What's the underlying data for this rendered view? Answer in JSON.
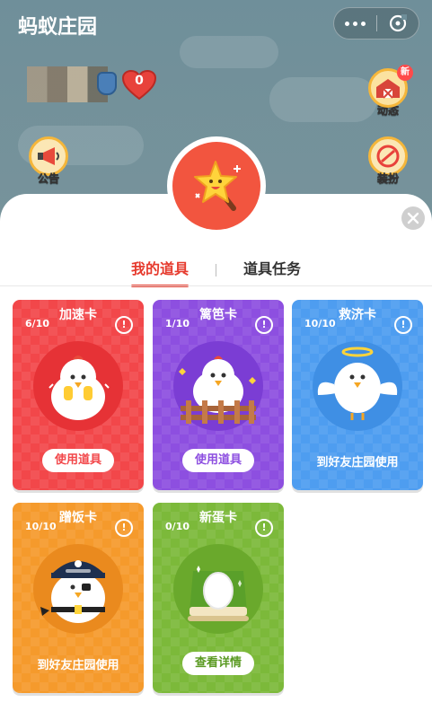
{
  "app": {
    "title": "蚂蚁庄园"
  },
  "user": {
    "heart_count": "0"
  },
  "side_buttons": {
    "announce": "公告",
    "news": "动态",
    "news_tag": "新",
    "dress": "装扮"
  },
  "tabs": [
    {
      "label": "我的道具",
      "active": true
    },
    {
      "label": "道具任务",
      "active": false
    }
  ],
  "cards": [
    {
      "title": "加速卡",
      "count": "6/10",
      "action": "使用道具",
      "color": "#f2474a",
      "action_color": "#f2474a",
      "button": true
    },
    {
      "title": "篱笆卡",
      "count": "1/10",
      "action": "使用道具",
      "color": "#8d4fe0",
      "action_color": "#8d4fe0",
      "button": true
    },
    {
      "title": "救济卡",
      "count": "10/10",
      "action": "到好友庄园使用",
      "color": "#4e9df0",
      "action_color": "#ffffff",
      "button": false
    },
    {
      "title": "蹭饭卡",
      "count": "10/10",
      "action": "到好友庄园使用",
      "color": "#f59a2c",
      "action_color": "#ffffff",
      "button": false
    },
    {
      "title": "新蛋卡",
      "count": "0/10",
      "action": "查看详情",
      "color": "#7cb93a",
      "action_color": "#7cb93a",
      "button": true
    }
  ],
  "colors": {
    "accent": "#e63b2e",
    "sheet_icon": "#f2553f"
  }
}
